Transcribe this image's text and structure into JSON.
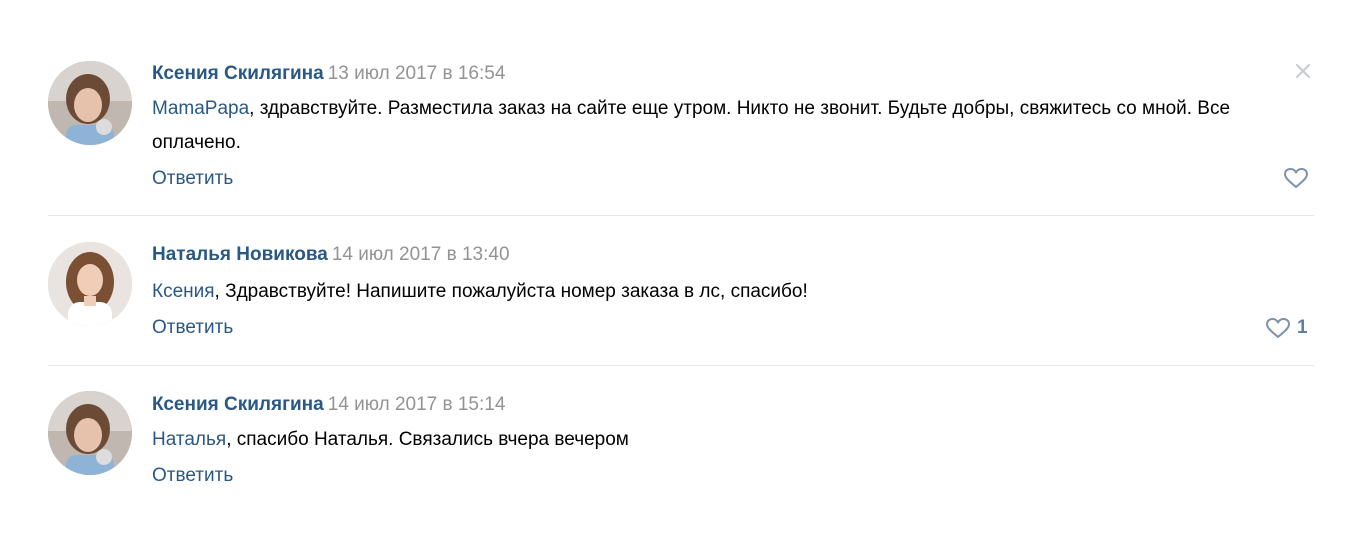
{
  "comments": [
    {
      "author": "Ксения Скилягина",
      "date": "13 июл 2017 в 16:54",
      "mention": "MamaPapa",
      "text": ", здравствуйте. Разместила заказ на сайте еще утром. Никто не звонит. Будьте добры, свяжитесь со мной. Все оплачено.",
      "reply_label": "Ответить",
      "likes": ""
    },
    {
      "author": "Наталья Новикова",
      "date": "14 июл 2017 в 13:40",
      "mention": "Ксения",
      "text": ", Здравствуйте! Напишите пожалуйста номер заказа в лс, спасибо!",
      "reply_label": "Ответить",
      "likes": "1"
    },
    {
      "author": "Ксения Скилягина",
      "date": "14 июл 2017 в 15:14",
      "mention": "Наталья",
      "text": ", спасибо Наталья. Связались вчера вечером",
      "reply_label": "Ответить"
    }
  ],
  "icons": {
    "close": "close-icon",
    "like": "heart-icon"
  },
  "colors": {
    "link": "#2a5885",
    "muted": "#939393",
    "divider": "#e3e7ec"
  }
}
